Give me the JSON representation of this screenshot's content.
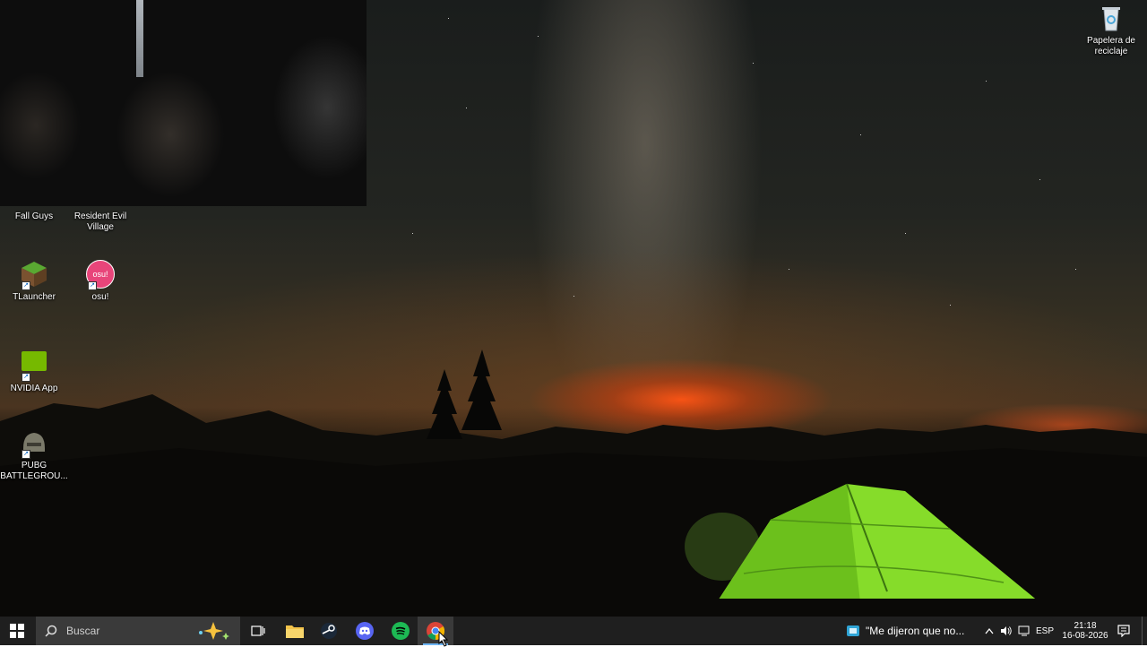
{
  "desktop": {
    "icons": [
      {
        "label": "Fall Guys",
        "icon": "fall-guys-icon"
      },
      {
        "label": "Resident Evil Village",
        "icon": "resident-evil-icon"
      },
      {
        "label": "TLauncher",
        "icon": "tlauncher-icon"
      },
      {
        "label": "osu!",
        "icon": "osu-icon",
        "icon_text": "osu!"
      },
      {
        "label": "NVIDIA App",
        "icon": "nvidia-icon"
      },
      {
        "label": "PUBG BATTLEGROU...",
        "icon": "pubg-icon"
      },
      {
        "label": "Papelera de reciclaje",
        "icon": "recycle-bin-icon"
      }
    ]
  },
  "taskbar": {
    "start_icon": "windows-logo-icon",
    "search": {
      "placeholder": "Buscar",
      "icon": "search-icon"
    },
    "task_view_icon": "task-view-icon",
    "pinned_apps": [
      {
        "name": "file-explorer",
        "icon": "folder-icon"
      },
      {
        "name": "steam",
        "icon": "steam-icon"
      },
      {
        "name": "discord",
        "icon": "discord-icon"
      },
      {
        "name": "spotify",
        "icon": "spotify-icon"
      },
      {
        "name": "chrome",
        "icon": "chrome-icon",
        "active": true
      }
    ],
    "media": {
      "text": "\"Me dijeron que no...",
      "icon": "media-app-icon"
    },
    "tray": {
      "language": "ESP",
      "time": "21:18",
      "date": "16-08-2026"
    }
  },
  "colors": {
    "taskbar_bg": "#1f1f1f",
    "search_bg": "#3a3a3a",
    "osu_pink": "#e8457a",
    "nvidia_green": "#76b900",
    "spotify_green": "#1db954",
    "discord_blurple": "#5865f2",
    "tent_green": "#7fd42a"
  }
}
